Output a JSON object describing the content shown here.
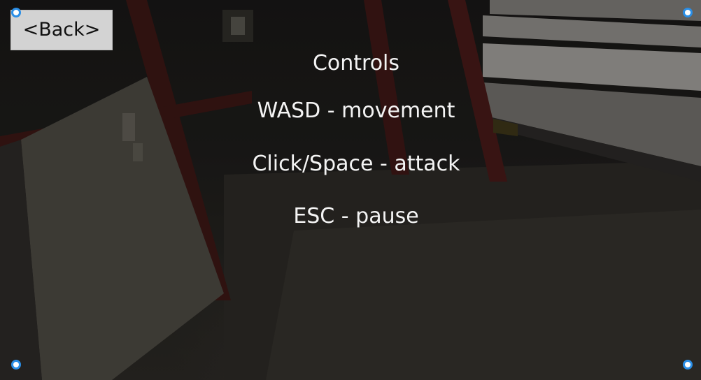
{
  "back_button": {
    "label": "<Back>"
  },
  "controls": {
    "title": "Controls",
    "lines": [
      "WASD - movement",
      "Click/Space - attack",
      "ESC - pause"
    ]
  },
  "colors": {
    "text": "#f4f4f4",
    "button_bg": "#d3d3d3",
    "handle_border": "#2a8ee6"
  },
  "icons": {
    "handle_icon": "selection-handle-circle"
  }
}
